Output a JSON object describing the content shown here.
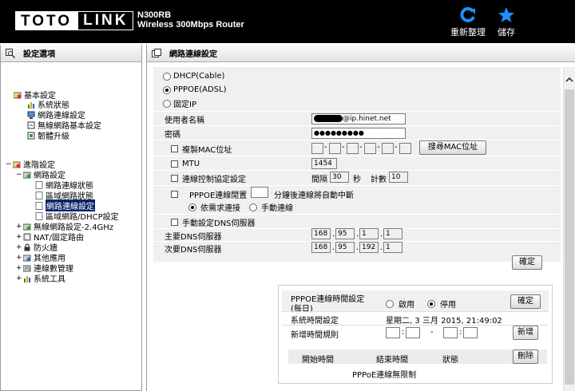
{
  "header": {
    "logo_left": "TOTO",
    "logo_right": "LINK",
    "model": "N300RB",
    "subtitle": "Wireless 300Mbps Router",
    "refresh_label": "重新整理",
    "save_label": "儲存"
  },
  "sidebar": {
    "title": "設定選項",
    "basic": {
      "label": "基本設定",
      "items": [
        "系統狀態",
        "網路連線設定",
        "無線網路基本設定",
        "韌體升級"
      ]
    },
    "advanced": {
      "label": "進階設定",
      "network": {
        "label": "網路設定",
        "items": [
          "網路連線狀態",
          "區域網路狀態",
          "網路連線設定",
          "區域網路/DHCP設定"
        ]
      },
      "items": [
        "無線網路設定-2.4GHz",
        "NAT/固定路由",
        "防火牆",
        "其他應用",
        "連線數管理",
        "系統工具"
      ]
    }
  },
  "main": {
    "title": "網路連線設定",
    "wan_types": [
      "DHCP(Cable)",
      "PPPOE(ADSL)",
      "固定IP"
    ],
    "selected_wan": 1,
    "username_label": "使用者名稱",
    "username_value": "@ip.hinet.net",
    "password_label": "密碼",
    "password_value": "●●●●●●●●●",
    "clone_mac_label": "複製MAC位址",
    "mac_fields": [
      "",
      "",
      "",
      "",
      "",
      ""
    ],
    "scan_mac_button": "搜尋MAC位址",
    "mtu_label": "MTU",
    "mtu_value": "1454",
    "keepalive_label": "連線控制協定設定",
    "interval_label": "間隔",
    "interval_value": "30",
    "seconds_label": "秒",
    "count_label": "計數",
    "count_value": "10",
    "idle_label": "PPPOE連線閒置",
    "idle_suffix": "分鐘後連線將自動中斷",
    "connect_on_demand": "依需求連接",
    "manual_connect": "手動連線",
    "manual_dns_label": "手動設定DNS伺服器",
    "primary_dns_label": "主要DNS伺服器",
    "primary_dns": [
      "168",
      "95",
      "1",
      "1"
    ],
    "secondary_dns_label": "次要DNS伺服器",
    "secondary_dns": [
      "168",
      "95",
      "192",
      "1"
    ],
    "confirm_button": "確定"
  },
  "schedule": {
    "title_line1": "PPPOE連線時間設定",
    "title_line2": "(每日)",
    "enable_label": "啟用",
    "disable_label": "停用",
    "selected": "disable",
    "confirm_button": "確定",
    "system_time_label": "系統時間設定",
    "system_time_value": "星期二, 3 三月 2015, 21:49:02",
    "add_rule_label": "新增時間規則",
    "add_button": "新增",
    "col_start": "開始時間",
    "col_end": "結束時間",
    "col_status": "狀態",
    "delete_button": "刪除",
    "unlimited_text": "PPPoE連線無限制"
  }
}
